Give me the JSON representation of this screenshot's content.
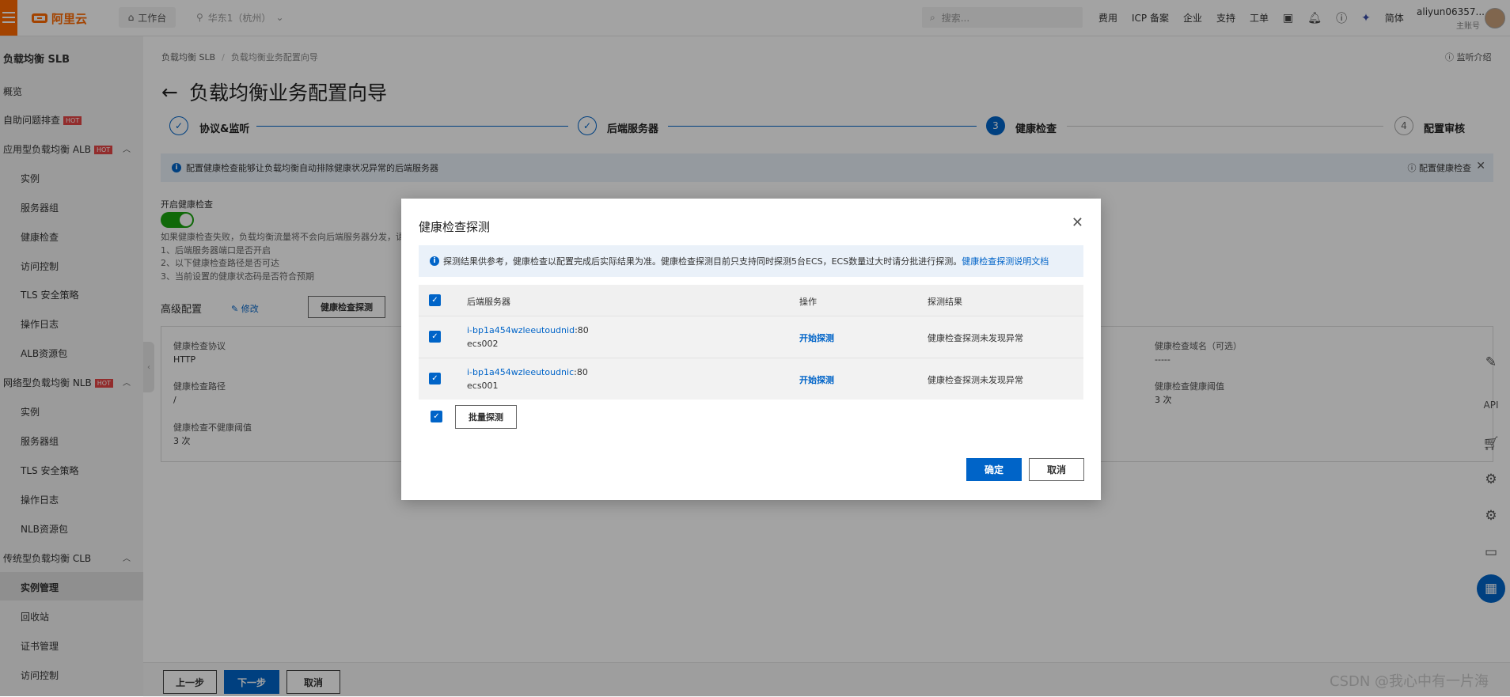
{
  "topbar": {
    "logo_text": "阿里云",
    "workbench": "工作台",
    "region": "华东1（杭州）",
    "search_placeholder": "搜索...",
    "links": [
      "费用",
      "ICP 备案",
      "企业",
      "支持",
      "工单"
    ],
    "lang": "简体",
    "user_name": "aliyun06357...",
    "user_sub": "主账号"
  },
  "sidebar": {
    "title": "负载均衡 SLB",
    "items": [
      {
        "label": "概览"
      },
      {
        "label": "自助问题排查",
        "badge": "HOT"
      },
      {
        "label": "应用型负载均衡 ALB",
        "badge": "HOT"
      },
      {
        "label": "实例"
      },
      {
        "label": "服务器组"
      },
      {
        "label": "健康检查"
      },
      {
        "label": "访问控制"
      },
      {
        "label": "TLS 安全策略"
      },
      {
        "label": "操作日志"
      },
      {
        "label": "ALB资源包"
      },
      {
        "label": "网络型负载均衡 NLB",
        "badge": "HOT"
      },
      {
        "label": "实例"
      },
      {
        "label": "服务器组"
      },
      {
        "label": "TLS 安全策略"
      },
      {
        "label": "操作日志"
      },
      {
        "label": "NLB资源包"
      },
      {
        "label": "传统型负载均衡 CLB"
      },
      {
        "label": "实例管理"
      },
      {
        "label": "回收站"
      },
      {
        "label": "证书管理"
      },
      {
        "label": "访问控制"
      }
    ]
  },
  "breadcrumb": [
    "负载均衡 SLB",
    "负载均衡业务配置向导"
  ],
  "help_link": "监听介绍",
  "page_title": "负载均衡业务配置向导",
  "steps": [
    {
      "num": "✓",
      "label": "协议&监听"
    },
    {
      "num": "✓",
      "label": "后端服务器"
    },
    {
      "num": "3",
      "label": "健康检查"
    },
    {
      "num": "4",
      "label": "配置审核"
    }
  ],
  "info_bar": {
    "text": "配置健康检查能够让负载均衡自动排除健康状况异常的后端服务器",
    "right": "配置健康检查"
  },
  "health_check": {
    "toggle_label": "开启健康检查",
    "note": [
      "如果健康检查失败，负载均衡流量将不会向后端服务器分发，请",
      "1、后端服务器端口是否开启",
      "2、以下健康检查路径是否可达",
      "3、当前设置的健康状态码是否符合预期"
    ],
    "advanced_title": "高级配置",
    "edit": "修改",
    "probe_button": "健康检查探测",
    "fields": {
      "protocol_label": "健康检查协议",
      "protocol_value": "HTTP",
      "path_label": "健康检查路径",
      "path_value": "/",
      "unhealthy_label": "健康检查不健康阈值",
      "unhealthy_value": "3 次",
      "domain_label": "健康检查域名（可选）",
      "domain_value": "-----",
      "healthy_label": "健康检查健康阈值",
      "healthy_value": "3 次"
    }
  },
  "footer": {
    "prev": "上一步",
    "next": "下一步",
    "cancel": "取消"
  },
  "watermark": "CSDN @我心中有一片海",
  "modal": {
    "title": "健康检查探测",
    "info_text": "探测结果供参考，健康检查以配置完成后实际结果为准。健康检查探测目前只支持同时探测5台ECS，ECS数量过大时请分批进行探测。",
    "info_link": "健康检查探测说明文档",
    "columns": [
      "后端服务器",
      "操作",
      "探测结果"
    ],
    "rows": [
      {
        "id": "i-bp1a454wzleeutoudnid",
        "port": ":80",
        "name": "ecs002",
        "op": "开始探测",
        "result": "健康检查探测未发现异常"
      },
      {
        "id": "i-bp1a454wzleeutoudnic",
        "port": ":80",
        "name": "ecs001",
        "op": "开始探测",
        "result": "健康检查探测未发现异常"
      }
    ],
    "batch_button": "批量探测",
    "ok": "确定",
    "cancel": "取消"
  },
  "colors": {
    "accent": "#0064c8",
    "brand": "#ff6a00",
    "toggle_on": "#1aa50f",
    "hot": "#e54545"
  }
}
